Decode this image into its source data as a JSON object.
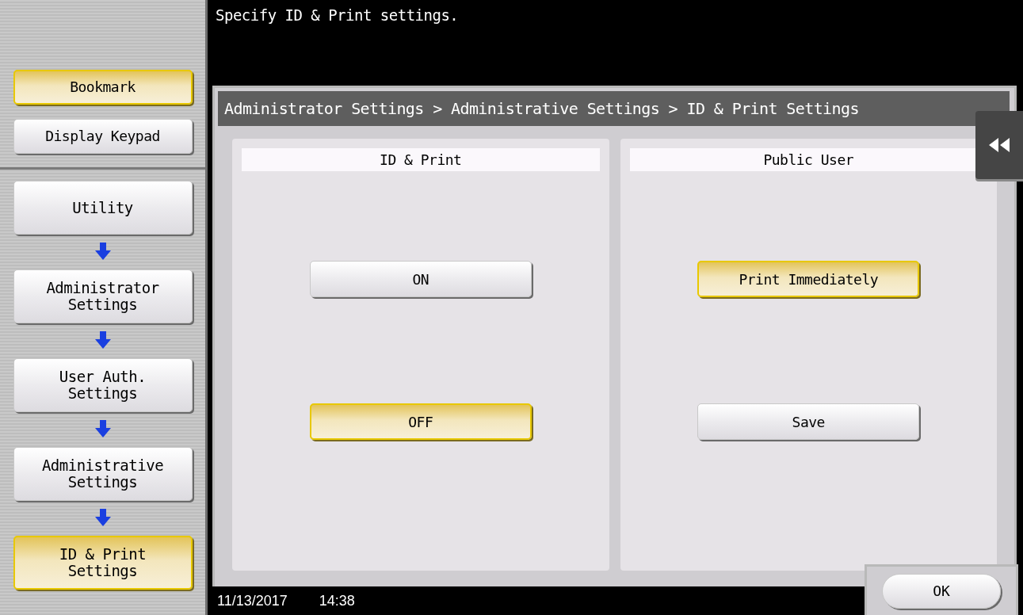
{
  "message": "Specify ID & Print settings.",
  "top_buttons": [
    {
      "label": "Bookmark",
      "selected": true
    },
    {
      "label": "Display Keypad",
      "selected": false
    }
  ],
  "nav": [
    {
      "label": "Utility",
      "selected": false
    },
    {
      "label": "Administrator Settings",
      "selected": false
    },
    {
      "label": "User Auth. Settings",
      "selected": false
    },
    {
      "label": "Administrative Settings",
      "selected": false
    },
    {
      "label": "ID & Print Settings",
      "selected": true
    }
  ],
  "breadcrumb": "Administrator Settings > Administrative Settings > ID & Print Settings",
  "columns": [
    {
      "title": "ID & Print",
      "options": [
        {
          "label": "ON",
          "selected": false
        },
        {
          "label": "OFF",
          "selected": true
        }
      ]
    },
    {
      "title": "Public User",
      "options": [
        {
          "label": "Print Immediately",
          "selected": true
        },
        {
          "label": "Save",
          "selected": false
        }
      ]
    }
  ],
  "status_bar": {
    "date": "11/13/2017",
    "time": "14:38"
  },
  "ok_button": "OK"
}
